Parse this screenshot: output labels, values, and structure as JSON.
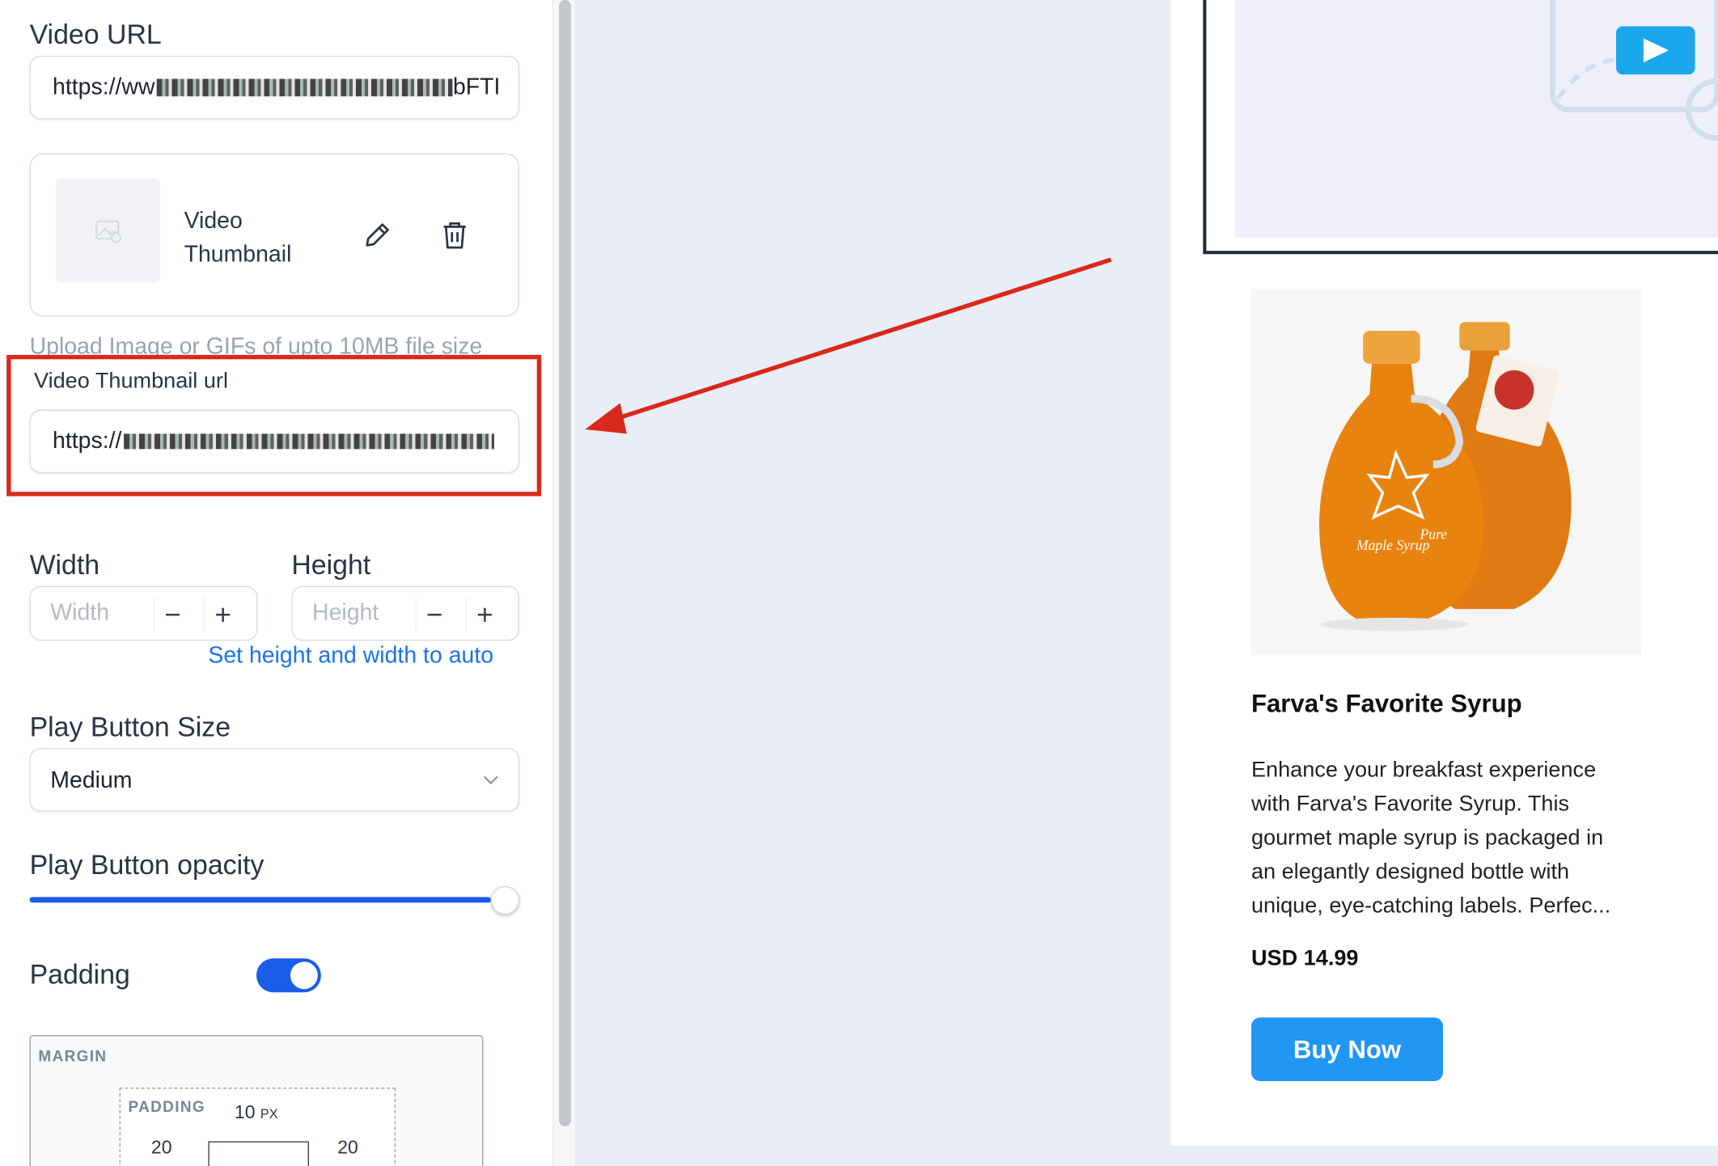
{
  "panel": {
    "video_url": {
      "label": "Video URL",
      "value_prefix": "https://ww",
      "value_suffix": "bFTI"
    },
    "thumbnail": {
      "title_line1": "Video",
      "title_line2": "Thumbnail",
      "edit_icon": "pencil-icon",
      "delete_icon": "trash-icon",
      "placeholder_icon": "image-icon"
    },
    "upload_hint": "Upload Image or GIFs of upto 10MB file size",
    "thumbnail_url": {
      "label": "Video Thumbnail url",
      "value_prefix": "https://"
    },
    "width": {
      "label": "Width",
      "placeholder": "Width"
    },
    "height": {
      "label": "Height",
      "placeholder": "Height"
    },
    "stepper": {
      "minus": "−",
      "plus": "+"
    },
    "auto_link": "Set height and width to auto",
    "play_button_size": {
      "label": "Play Button Size",
      "value": "Medium"
    },
    "play_button_opacity": {
      "label": "Play Button opacity",
      "value": 1.0
    },
    "padding": {
      "label": "Padding",
      "enabled": true
    },
    "spacing": {
      "margin_label": "MARGIN",
      "padding_label": "PADDING",
      "top": "10",
      "left": "20",
      "right": "20",
      "unit": "PX"
    }
  },
  "preview": {
    "product": {
      "title": "Farva's Favorite Syrup",
      "description_lines": [
        "Enhance your breakfast experience",
        "with Farva's Favorite Syrup. This",
        "gourmet maple syrup is packaged in",
        "an elegantly designed bottle with",
        "unique, eye-catching labels. Perfec..."
      ],
      "price": "USD 14.99",
      "button": "Buy Now",
      "bottle_label_line1": "Pure",
      "bottle_label_line2": "Maple Syrup"
    }
  },
  "colors": {
    "accent": "#1a5de8",
    "link": "#1a73e8",
    "highlight": "#d9291c",
    "buy_button": "#2196f3",
    "play_button": "#1aa7ec",
    "canvas": "#e9edf5"
  }
}
